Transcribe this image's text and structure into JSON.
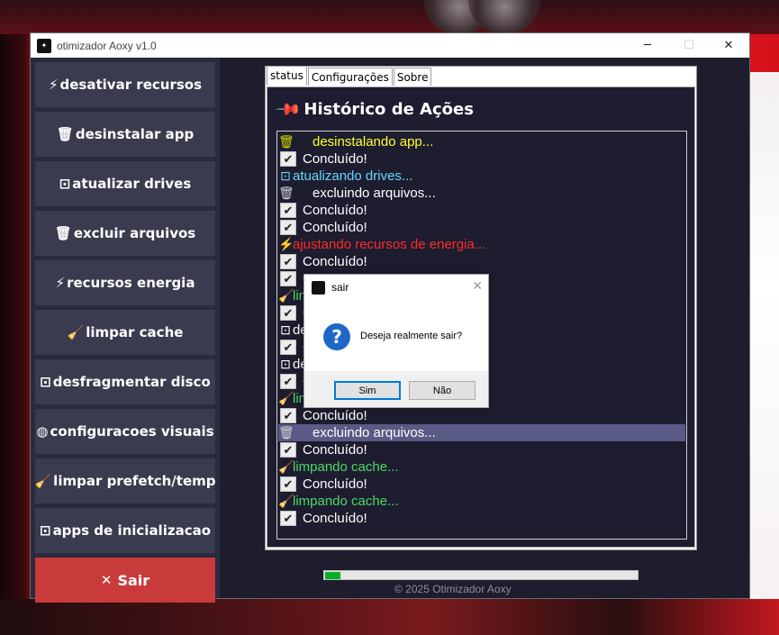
{
  "window": {
    "title": "otimizador Aoxy v1.0",
    "minimize_icon": "minimize-icon",
    "maximize_icon": "maximize-icon",
    "close_icon": "close-icon"
  },
  "sidebar": {
    "items": [
      {
        "icon": "lightning-icon",
        "glyph": "⚡",
        "label": "desativar recursos"
      },
      {
        "icon": "trash-icon",
        "glyph": "🗑",
        "label": "desinstalar app"
      },
      {
        "icon": "drive-icon",
        "glyph": "⊡",
        "label": "atualizar drives"
      },
      {
        "icon": "trash-icon",
        "glyph": "🗑",
        "label": "excluir arquivos"
      },
      {
        "icon": "lightning-icon",
        "glyph": "⚡",
        "label": "recursos energia"
      },
      {
        "icon": "broom-icon",
        "glyph": "🧹",
        "label": "limpar cache"
      },
      {
        "icon": "disk-icon",
        "glyph": "⊡",
        "label": "desfragmentar disco"
      },
      {
        "icon": "palette-icon",
        "glyph": "◍",
        "label": "configuracoes visuais"
      },
      {
        "icon": "broom-icon",
        "glyph": "🧹",
        "label": "limpar prefetch/temp"
      },
      {
        "icon": "startup-icon",
        "glyph": "⊡",
        "label": "apps de inicializacao"
      }
    ],
    "exit": {
      "icon": "x-icon",
      "glyph": "✕",
      "label": "Sair"
    }
  },
  "tabs": [
    {
      "label": "status",
      "active": true
    },
    {
      "label": "Configurações",
      "active": false
    },
    {
      "label": "Sobre",
      "active": false
    }
  ],
  "history": {
    "title": "Histórico de Ações",
    "title_icon": "pin-icon",
    "lines": [
      {
        "kind": "action",
        "icon": "trash-icon",
        "glyph": "🗑",
        "text": "desinstalando app...",
        "color": "#ffff33"
      },
      {
        "kind": "done",
        "text": "Concluído!",
        "color": "#ffffff"
      },
      {
        "kind": "action",
        "icon": "drive-icon",
        "glyph": "⊡",
        "text": "atualizando drives...",
        "color": "#66d6ff"
      },
      {
        "kind": "action",
        "icon": "trash-icon",
        "glyph": "🗑",
        "text": "excluindo arquivos...",
        "color": "#ffffff"
      },
      {
        "kind": "done",
        "text": "Concluído!",
        "color": "#ffffff"
      },
      {
        "kind": "done",
        "text": "Concluído!",
        "color": "#ffffff"
      },
      {
        "kind": "action",
        "icon": "lightning-icon",
        "glyph": "⚡",
        "text": "ajustando recursos de energia...",
        "color": "#ff2a2a"
      },
      {
        "kind": "done",
        "text": "Concluído!",
        "color": "#ffffff"
      },
      {
        "kind": "done",
        "text": "C",
        "color": "#ffffff"
      },
      {
        "kind": "action",
        "icon": "broom-icon",
        "glyph": "🧹",
        "text": "lim",
        "color": "#4cd964"
      },
      {
        "kind": "done",
        "text": "C",
        "color": "#ffffff"
      },
      {
        "kind": "action",
        "icon": "disk-icon",
        "glyph": "⊡",
        "text": "de",
        "color": "#ffffff"
      },
      {
        "kind": "done",
        "text": "C",
        "color": "#ffffff"
      },
      {
        "kind": "action",
        "icon": "disk-icon",
        "glyph": "⊡",
        "text": "de",
        "color": "#ffffff"
      },
      {
        "kind": "done",
        "text": "C",
        "color": "#ffffff"
      },
      {
        "kind": "action",
        "icon": "broom-icon",
        "glyph": "🧹",
        "text": "lim",
        "color": "#4cd964"
      },
      {
        "kind": "done",
        "text": "Concluído!",
        "color": "#ffffff"
      },
      {
        "kind": "action",
        "icon": "trash-icon",
        "glyph": "🗑",
        "text": "excluindo arquivos...",
        "color": "#ffffff",
        "selected": true
      },
      {
        "kind": "done",
        "text": "Concluído!",
        "color": "#ffffff"
      },
      {
        "kind": "action",
        "icon": "broom-icon",
        "glyph": "🧹",
        "text": "limpando cache...",
        "color": "#4cd964"
      },
      {
        "kind": "done",
        "text": "Concluído!",
        "color": "#ffffff"
      },
      {
        "kind": "action",
        "icon": "broom-icon",
        "glyph": "🧹",
        "text": "limpando cache...",
        "color": "#4cd964"
      },
      {
        "kind": "done",
        "text": "Concluído!",
        "color": "#ffffff"
      }
    ]
  },
  "progress": {
    "fraction": 0.05,
    "color": "#06b025"
  },
  "footer": {
    "text": "© 2025 Otimizador Aoxy"
  },
  "dialog": {
    "title": "sair",
    "message": "Deseja realmente sair?",
    "icon": "question-icon",
    "yes_label": "Sim",
    "no_label": "Não"
  },
  "colors": {
    "sidebar_button": "#3a3b4e",
    "exit_button": "#c93a3a",
    "background": "#1d1d2e"
  }
}
